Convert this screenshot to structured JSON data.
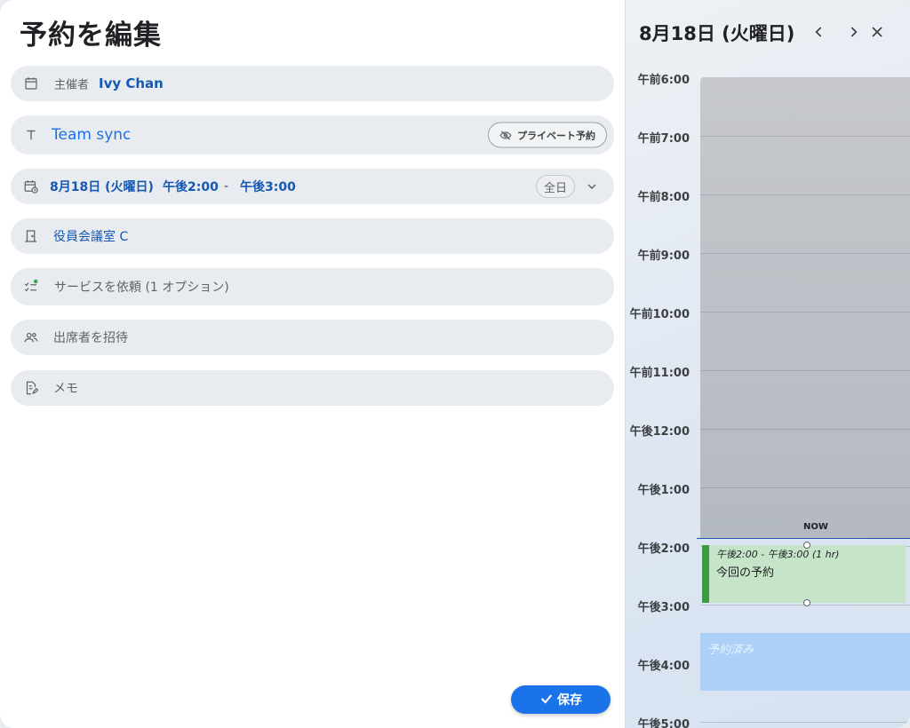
{
  "form": {
    "title": "予約を編集",
    "organizer": {
      "label": "主催者",
      "name": "Ivy Chan"
    },
    "event_title": {
      "value": "Team sync",
      "private_label": "プライベート予約"
    },
    "datetime": {
      "date": "8月18日 (火曜日)",
      "start": "午後2:00",
      "separator": "-",
      "end": "午後3:00",
      "allday_label": "全日"
    },
    "room": "役員会議室 C",
    "services": "サービスを依頼 (1 オプション)",
    "attendees_placeholder": "出席者を招待",
    "notes_placeholder": "メモ",
    "save_label": "保存"
  },
  "calendar": {
    "day_title": "8月18日 (火曜日)",
    "hours": [
      "午前6:00",
      "午前7:00",
      "午前8:00",
      "午前9:00",
      "午前10:00",
      "午前11:00",
      "午後12:00",
      "午後1:00",
      "午後2:00",
      "午後3:00",
      "午後4:00",
      "午後5:00"
    ],
    "now_label": "NOW",
    "event": {
      "time": "午後2:00 - 午後3:00 (1 hr)",
      "title": "今回の予約"
    },
    "booked_label": "予約済み"
  },
  "colors": {
    "accent": "#1a73e8",
    "link_text": "#1559b3",
    "event_fill": "#c6e5c8",
    "event_bar": "#3c9a45",
    "booked_fill": "#acd0f7",
    "past_fill": "#bfc2c7"
  }
}
